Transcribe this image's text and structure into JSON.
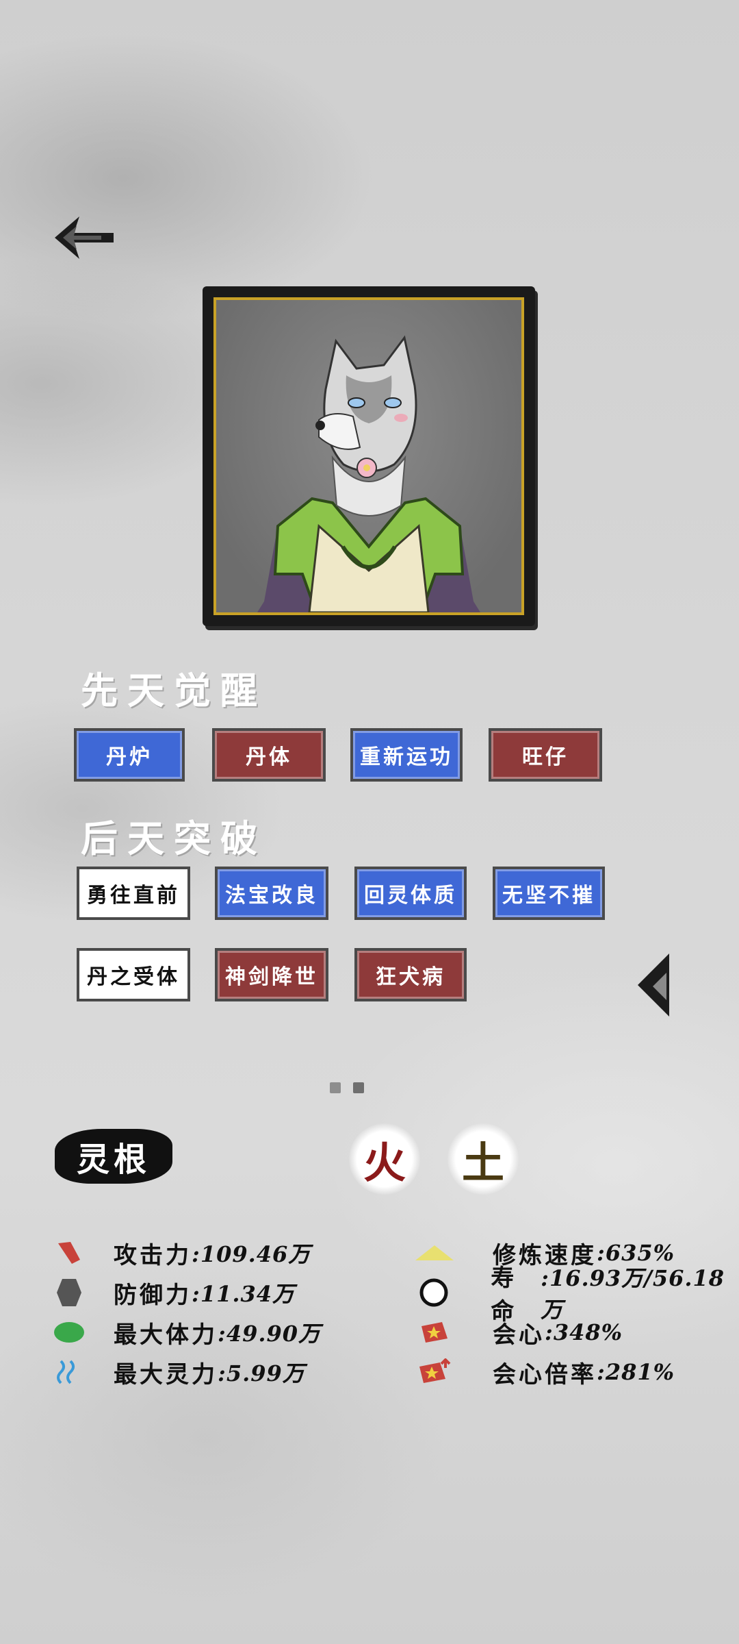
{
  "nav": {
    "back_icon": "back-arrow-icon"
  },
  "portrait": {
    "description_icon": "character-portrait-wolf"
  },
  "innate": {
    "title": "先天觉醒",
    "chips": [
      {
        "label": "丹炉",
        "style": "blue"
      },
      {
        "label": "丹体",
        "style": "red"
      },
      {
        "label": "重新运功",
        "style": "blue"
      },
      {
        "label": "旺仔",
        "style": "red"
      }
    ]
  },
  "acquired": {
    "title": "后天突破",
    "chips": [
      {
        "label": "勇往直前",
        "style": "white"
      },
      {
        "label": "法宝改良",
        "style": "blue"
      },
      {
        "label": "回灵体质",
        "style": "blue"
      },
      {
        "label": "无坚不摧",
        "style": "blue"
      },
      {
        "label": "丹之受体",
        "style": "white"
      },
      {
        "label": "神剑降世",
        "style": "red"
      },
      {
        "label": "狂犬病",
        "style": "red"
      }
    ]
  },
  "pagination": {
    "pages": 2,
    "current": 2
  },
  "spirit_root": {
    "title": "灵根",
    "elements": [
      {
        "label": "火",
        "color": "#8b1a1a"
      },
      {
        "label": "土",
        "color": "#4a3a12"
      }
    ]
  },
  "stats": {
    "left": [
      {
        "label": "攻击力",
        "value": ":109.46万",
        "icon": "attack-icon"
      },
      {
        "label": "防御力",
        "value": ":11.34万",
        "icon": "defense-icon"
      },
      {
        "label": "最大体力",
        "value": ":49.90万",
        "icon": "health-icon"
      },
      {
        "label": "最大灵力",
        "value": ":5.99万",
        "icon": "mana-icon"
      }
    ],
    "right": [
      {
        "label": "修炼速度",
        "value": ":635%",
        "icon": "cultivation-speed-icon"
      },
      {
        "label": "寿命",
        "value": ":16.93万/56.18万",
        "icon": "lifespan-icon"
      },
      {
        "label": "会心",
        "value": ":348%",
        "icon": "critical-icon"
      },
      {
        "label": "会心倍率",
        "value": ":281%",
        "icon": "critical-multiplier-icon"
      }
    ]
  }
}
